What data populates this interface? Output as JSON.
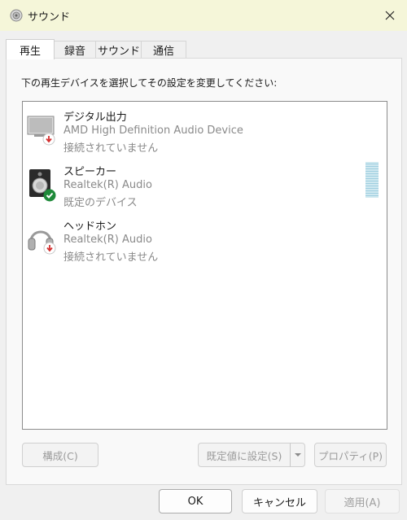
{
  "window": {
    "title": "サウンド",
    "icon": "speaker-icon",
    "close_icon": "close-icon"
  },
  "tabs": [
    {
      "label": "再生",
      "active": true
    },
    {
      "label": "録音",
      "active": false
    },
    {
      "label": "サウンド",
      "active": false
    },
    {
      "label": "通信",
      "active": false
    }
  ],
  "panel": {
    "instruction": "下の再生デバイスを選択してその設定を変更してください:"
  },
  "devices": [
    {
      "name": "デジタル出力",
      "driver": "AMD High Definition Audio Device",
      "status": "接続されていません",
      "icon": "monitor-icon",
      "badge": "disconnected-badge-icon"
    },
    {
      "name": "スピーカー",
      "driver": "Realtek(R) Audio",
      "status": "既定のデバイス",
      "icon": "speaker-device-icon",
      "badge": "default-check-icon"
    },
    {
      "name": "ヘッドホン",
      "driver": "Realtek(R) Audio",
      "status": "接続されていません",
      "icon": "headphones-icon",
      "badge": "disconnected-badge-icon"
    }
  ],
  "buttons": {
    "configure": "構成(C)",
    "set_default": "既定値に設定(S)",
    "properties": "プロパティ(P)",
    "ok": "OK",
    "cancel": "キャンセル",
    "apply": "適用(A)"
  },
  "colors": {
    "titlebar_bg": "#f5f6d9",
    "disconnected_red": "#d32f2f",
    "default_green": "#2e8b3e",
    "disabled_text": "#9b9b9b",
    "meter_blue": "#9fcfe0"
  }
}
